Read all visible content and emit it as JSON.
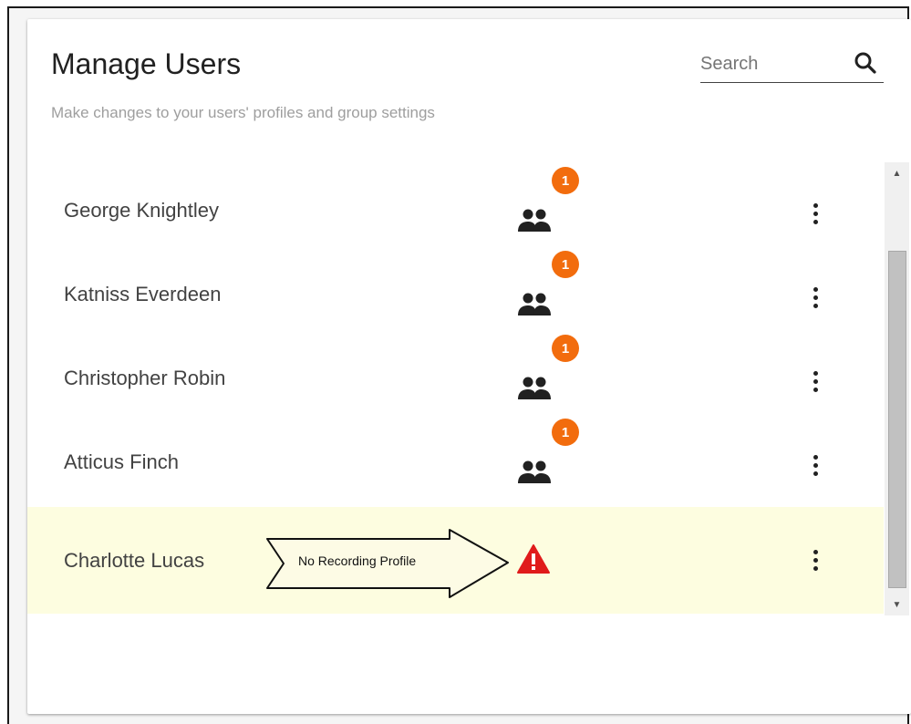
{
  "header": {
    "title": "Manage Users",
    "subtitle": "Make changes to your users' profiles and group settings"
  },
  "search": {
    "placeholder": "Search",
    "value": ""
  },
  "users": [
    {
      "name": "George Knightley",
      "badge": "1",
      "status": "group"
    },
    {
      "name": "Katniss Everdeen",
      "badge": "1",
      "status": "group"
    },
    {
      "name": "Christopher Robin",
      "badge": "1",
      "status": "group"
    },
    {
      "name": "Atticus Finch",
      "badge": "1",
      "status": "group"
    },
    {
      "name": "Charlotte Lucas",
      "badge": "",
      "status": "warning"
    }
  ],
  "callout": {
    "text": "No Recording Profile"
  },
  "colors": {
    "badge": "#f26c0d",
    "warning": "#e01b1b",
    "highlight_row": "#fdfde0"
  },
  "icons": {
    "search": "search-icon",
    "group": "group-icon",
    "more": "more-vert-icon",
    "warning": "warning-icon"
  }
}
